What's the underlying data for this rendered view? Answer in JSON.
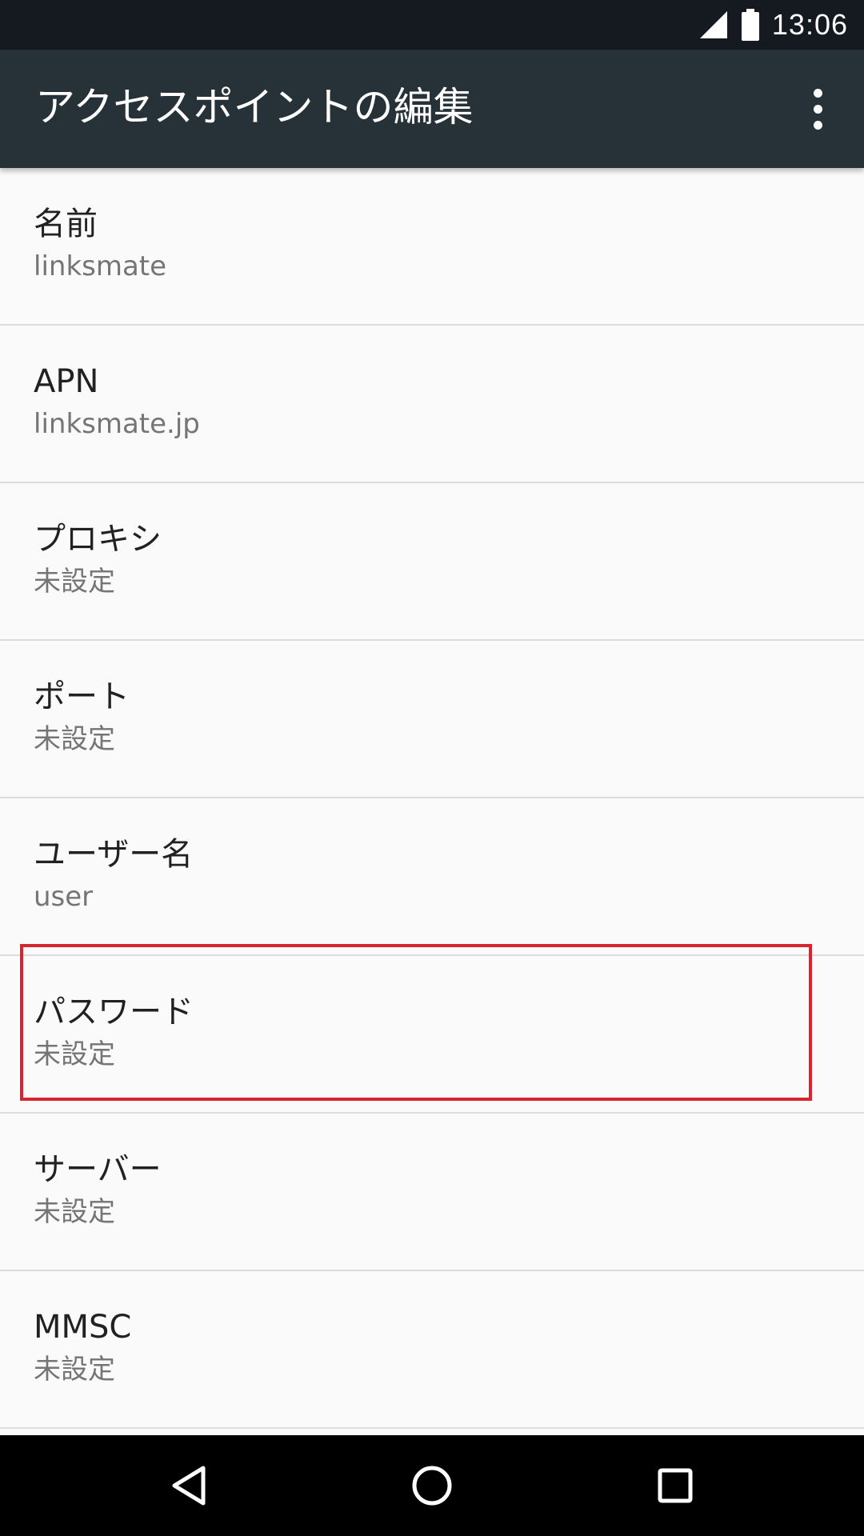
{
  "status_bar": {
    "time": "13:06",
    "icons": [
      "signal-icon",
      "battery-icon"
    ]
  },
  "app_bar": {
    "title": "アクセスポイントの編集",
    "overflow_icon": "more-vert-icon"
  },
  "settings": [
    {
      "title": "名前",
      "value": "linksmate"
    },
    {
      "title": "APN",
      "value": "linksmate.jp"
    },
    {
      "title": "プロキシ",
      "value": "未設定"
    },
    {
      "title": "ポート",
      "value": "未設定"
    },
    {
      "title": "ユーザー名",
      "value": "user"
    },
    {
      "title": "パスワード",
      "value": "未設定"
    },
    {
      "title": "サーバー",
      "value": "未設定"
    },
    {
      "title": "MMSC",
      "value": "未設定"
    }
  ],
  "highlight": {
    "target": "パスワード",
    "color": "#d9232d"
  },
  "nav_bar": {
    "icons": [
      "back-icon",
      "home-icon",
      "recents-icon"
    ]
  },
  "colors": {
    "status_bar": "#141a1f",
    "app_bar": "#263238",
    "background": "#fafafa",
    "divider": "#dcdcdc"
  }
}
